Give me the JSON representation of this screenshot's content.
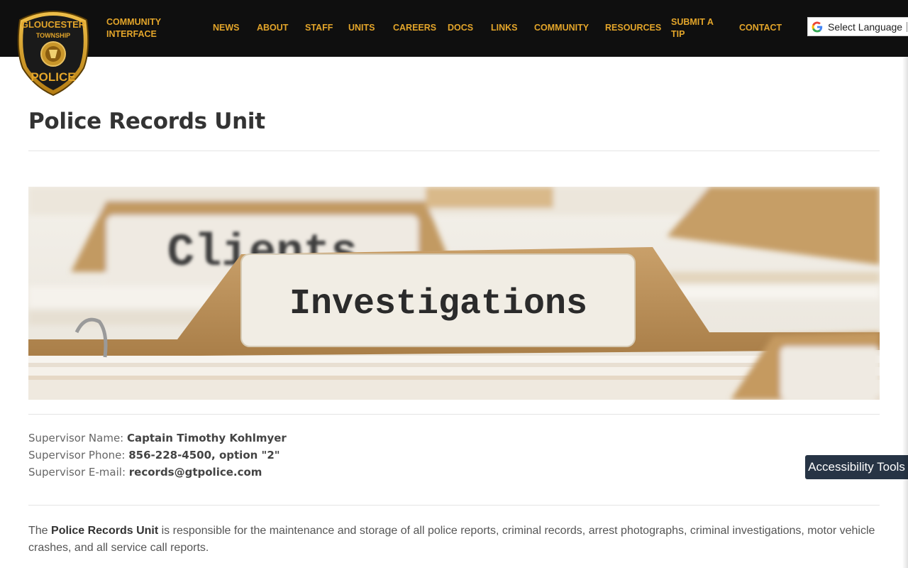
{
  "header": {
    "badge": {
      "top_text": "GLOUCESTER",
      "middle_text": "TOWNSHIP",
      "bottom_text": "POLICE"
    },
    "community_interface": "COMMUNITY INTERFACE",
    "nav": [
      {
        "label": "NEWS"
      },
      {
        "label": "ABOUT"
      },
      {
        "label": "STAFF"
      },
      {
        "label": "UNITS"
      },
      {
        "label": "CAREERS"
      },
      {
        "label": "DOCS"
      },
      {
        "label": "LINKS"
      },
      {
        "label": "COMMUNITY"
      },
      {
        "label": "RESOURCES"
      },
      {
        "label": "SUBMIT A TIP"
      },
      {
        "label": "CONTACT"
      }
    ],
    "language": {
      "label": "Select Language",
      "icon": "google-g-icon"
    }
  },
  "page": {
    "title": "Police Records Unit",
    "hero_labels": {
      "back_tab": "Clients",
      "front_tab": "Investigations"
    },
    "supervisor": {
      "name_label": "Supervisor Name: ",
      "name_value": "Captain Timothy Kohlmyer",
      "phone_label": "Supervisor Phone: ",
      "phone_value": "856-228-4500, option \"2\"",
      "email_label": "Supervisor E-mail: ",
      "email_value": "records@gtpolice.com"
    },
    "description": {
      "lead": "The ",
      "bold": "Police Records Unit",
      "rest": " is responsible for the maintenance and storage of all police reports, criminal records, arrest photographs, criminal investigations, motor vehicle crashes, and all service call reports."
    }
  },
  "accessibility_tools": "Accessibility Tools",
  "colors": {
    "header_bg": "#0f0f0f",
    "nav_gold": "#e3a52a",
    "a11y_bg": "#273445"
  }
}
